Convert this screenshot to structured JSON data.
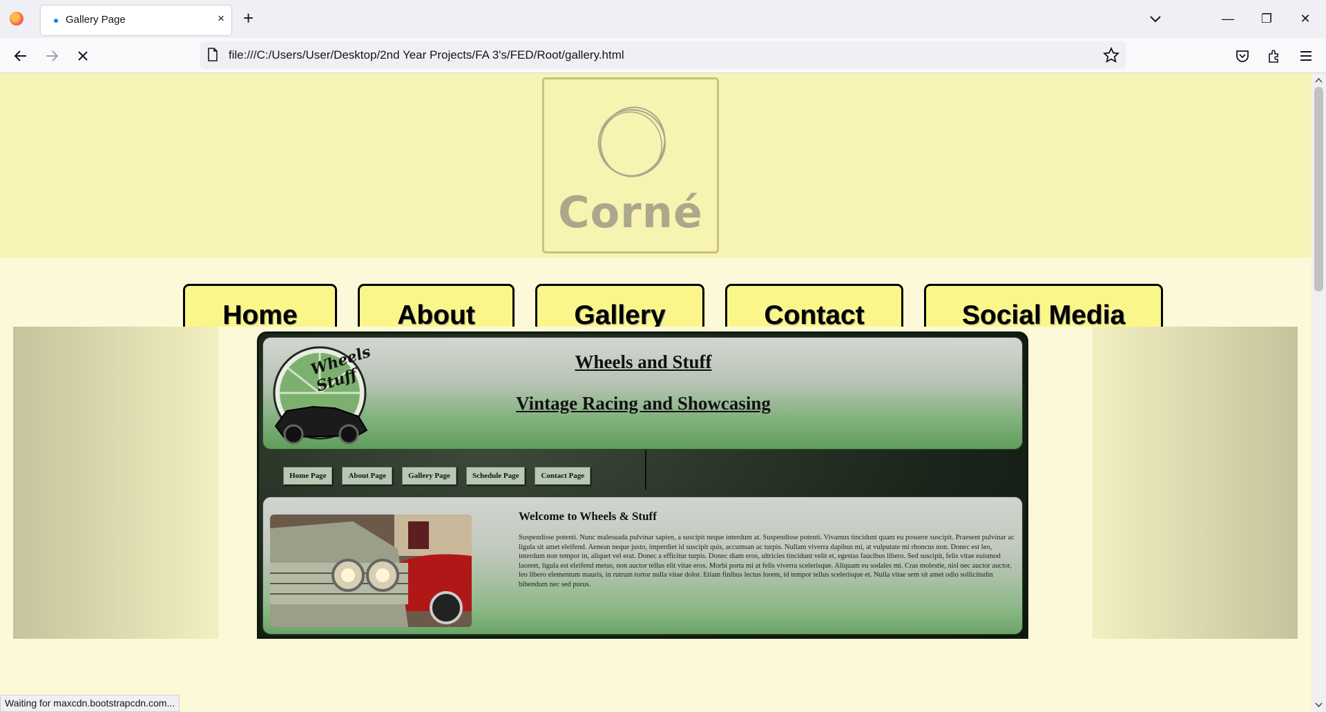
{
  "browser": {
    "tab_title": "Gallery Page",
    "tab_close": "×",
    "new_tab": "+",
    "url": "file:///C:/Users/User/Desktop/2nd Year Projects/FA 3's/FED/Root/gallery.html",
    "status": "Waiting for maxcdn.bootstrapcdn.com...",
    "window_buttons": {
      "minimize": "—",
      "restore": "❐",
      "close": "✕"
    }
  },
  "logo": {
    "text": "Corné",
    "color": "#aca88b"
  },
  "menu": {
    "home": "Home",
    "about": "About",
    "gallery": "Gallery",
    "contact": "Contact",
    "social": "Social Media",
    "button_color": "#fbf68a"
  },
  "preview": {
    "title": "Wheels and Stuff",
    "subtitle": "Vintage Racing and Showcasing",
    "badge_line1": "Wheels",
    "badge_line2": "Stuff",
    "nav": {
      "home": "Home Page",
      "about": "About Page",
      "gallery": "Gallery Page",
      "schedule": "Schedule Page",
      "contact": "Contact Page"
    },
    "welcome": "Welcome to Wheels & Stuff",
    "body_text": "Suspendisse potenti. Nunc malesuada pulvinar sapien, a suscipit neque interdum at. Suspendisse potenti. Vivamus tincidunt quam eu posuere suscipit. Praesent pulvinar ac ligula sit amet eleifend. Aenean neque justo, imperdiet id suscipit quis, accumsan ac turpis. Nullam viverra dapibus mi, at vulputate mi rhoncus non. Donec est leo, interdum non tempor in, aliquet vel erat. Donec a efficitur turpis. Donec diam eros, ultricies tincidunt velit et, egestas faucibus libero. Sed suscipit, felis vitae euismod laoreet, ligula est eleifend metus, non auctor tellus elit vitae eros. Morbi porta mi at felis viverra scelerisque. Aliquam eu sodales mi. Cras molestie, nisl nec auctor auctor, leo libero elementum mauris, in rutrum tortor nulla vitae dolor. Etiam finibus lectus lorem, id tempor tellus scelerisque et. Nulla vitae sem sit amet odio sollicitudin bibendum nec sed purus."
  },
  "colors": {
    "page_bg": "#fbf9d8",
    "header_bg": "#f7f3b6",
    "accent_green": "#5f9e5a"
  }
}
